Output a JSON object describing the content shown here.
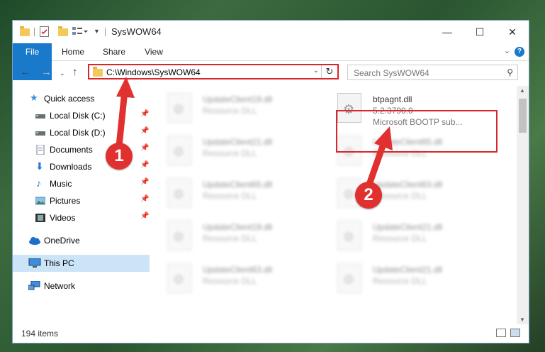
{
  "window": {
    "title": "SysWOW64",
    "controls": {
      "minimize": "—",
      "maximize": "☐",
      "close": "✕"
    }
  },
  "ribbon": {
    "tabs": [
      "File",
      "Home",
      "Share",
      "View"
    ],
    "help": "?"
  },
  "nav": {
    "address": "C:\\Windows\\SysWOW64",
    "search_placeholder": "Search SysWOW64"
  },
  "sidebar": {
    "items": [
      {
        "label": "Quick access",
        "icon": "star-icon"
      },
      {
        "label": "Local Disk (C:)",
        "icon": "drive-icon",
        "pinned": true
      },
      {
        "label": "Local Disk (D:)",
        "icon": "drive-icon",
        "pinned": true
      },
      {
        "label": "Documents",
        "icon": "documents-icon",
        "pinned": true
      },
      {
        "label": "Downloads",
        "icon": "download-icon",
        "pinned": true
      },
      {
        "label": "Music",
        "icon": "music-icon",
        "pinned": true
      },
      {
        "label": "Pictures",
        "icon": "pictures-icon",
        "pinned": true
      },
      {
        "label": "Videos",
        "icon": "video-icon",
        "pinned": true
      },
      {
        "label": "OneDrive",
        "icon": "cloud-icon"
      },
      {
        "label": "This PC",
        "icon": "computer-icon",
        "selected": true
      },
      {
        "label": "Network",
        "icon": "network-icon"
      }
    ]
  },
  "files": {
    "left": [
      {
        "name": "UpdateClient19.dll",
        "type": "Resource DLL"
      },
      {
        "name": "UpdateClient21.dll",
        "type": "Resource DLL"
      },
      {
        "name": "UpdateClient65.dll",
        "type": "Resource DLL"
      },
      {
        "name": "UpdateClient19.dll",
        "type": "Resource DLL"
      },
      {
        "name": "UpdateClient63.dll",
        "type": "Resource DLL"
      }
    ],
    "right": [
      {
        "name": "UpdateClient65.dll",
        "type": "Resource DLL"
      },
      {
        "name": "UpdateClient63.dll",
        "type": "Resource DLL"
      },
      {
        "name": "UpdateClient21.dll",
        "type": "Resource DLL"
      },
      {
        "name": "UpdateClient21.dll",
        "type": "Resource DLL"
      }
    ],
    "highlighted": {
      "name": "btpagnt.dll",
      "version": "5.2.3790.0",
      "description": "Microsoft BOOTP sub..."
    }
  },
  "status": {
    "item_count": "194 items"
  },
  "annotations": {
    "step1": "1",
    "step2": "2"
  },
  "colors": {
    "accent": "#1979ca",
    "annotation_red": "#e0302f",
    "selection": "#cce4f7"
  }
}
